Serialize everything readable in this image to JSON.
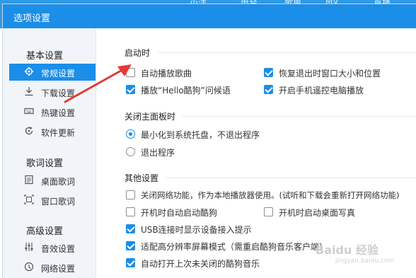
{
  "background": {
    "labels": [
      "小洋",
      "电台",
      "歌单",
      "MV",
      "直播"
    ]
  },
  "dialog": {
    "title": "选项设置"
  },
  "sidebar": {
    "groups": [
      {
        "title": "基本设置",
        "items": [
          {
            "label": "常规设置",
            "icon": "gear-icon",
            "active": true
          },
          {
            "label": "下载设置",
            "icon": "download-icon",
            "active": false
          },
          {
            "label": "热键设置",
            "icon": "keyboard-icon",
            "active": false
          },
          {
            "label": "软件更新",
            "icon": "refresh-icon",
            "active": false
          }
        ]
      },
      {
        "title": "歌词设置",
        "items": [
          {
            "label": "桌面歌词",
            "icon": "lyrics-icon",
            "active": false
          },
          {
            "label": "窗口歌词",
            "icon": "window-icon",
            "active": false
          }
        ]
      },
      {
        "title": "高级设置",
        "items": [
          {
            "label": "音效设置",
            "icon": "equalizer-icon",
            "active": false
          },
          {
            "label": "网络设置",
            "icon": "network-icon",
            "active": false
          }
        ]
      }
    ]
  },
  "content": {
    "startup": {
      "title": "启动时",
      "options": [
        {
          "label": "自动播放歌曲",
          "checked": false
        },
        {
          "label": "恢复退出时窗口大小和位置",
          "checked": true
        },
        {
          "label": "播放“Hello酷狗”问候语",
          "checked": true
        },
        {
          "label": "开启手机遥控电脑播放",
          "checked": true
        }
      ]
    },
    "close": {
      "title": "关闭主面板时",
      "options": [
        {
          "label": "最小化到系统托盘，不退出程序",
          "selected": true
        },
        {
          "label": "退出程序",
          "selected": false
        }
      ]
    },
    "other": {
      "title": "其他设置",
      "options": [
        {
          "label": "关闭网络功能，作为本地播放器使用。(试听和下载会重新打开网络功能)",
          "checked": false
        },
        {
          "label": "开机时自动启动酷狗",
          "checked": false
        },
        {
          "label": "开机时启动桌面写真",
          "checked": false
        },
        {
          "label": "USB连接时显示设备接入提示",
          "checked": true
        },
        {
          "label": "适配高分辨率屏幕模式（需重启酷狗音乐客户端）",
          "checked": true
        },
        {
          "label": "自动打开上次未关闭的酷狗音乐",
          "checked": true
        }
      ]
    }
  },
  "watermark": {
    "text": "Baidu 经验",
    "sub": "jingyan.baidu.com"
  },
  "colors": {
    "accent": "#1a8ee8",
    "arrow": "#e53935"
  }
}
